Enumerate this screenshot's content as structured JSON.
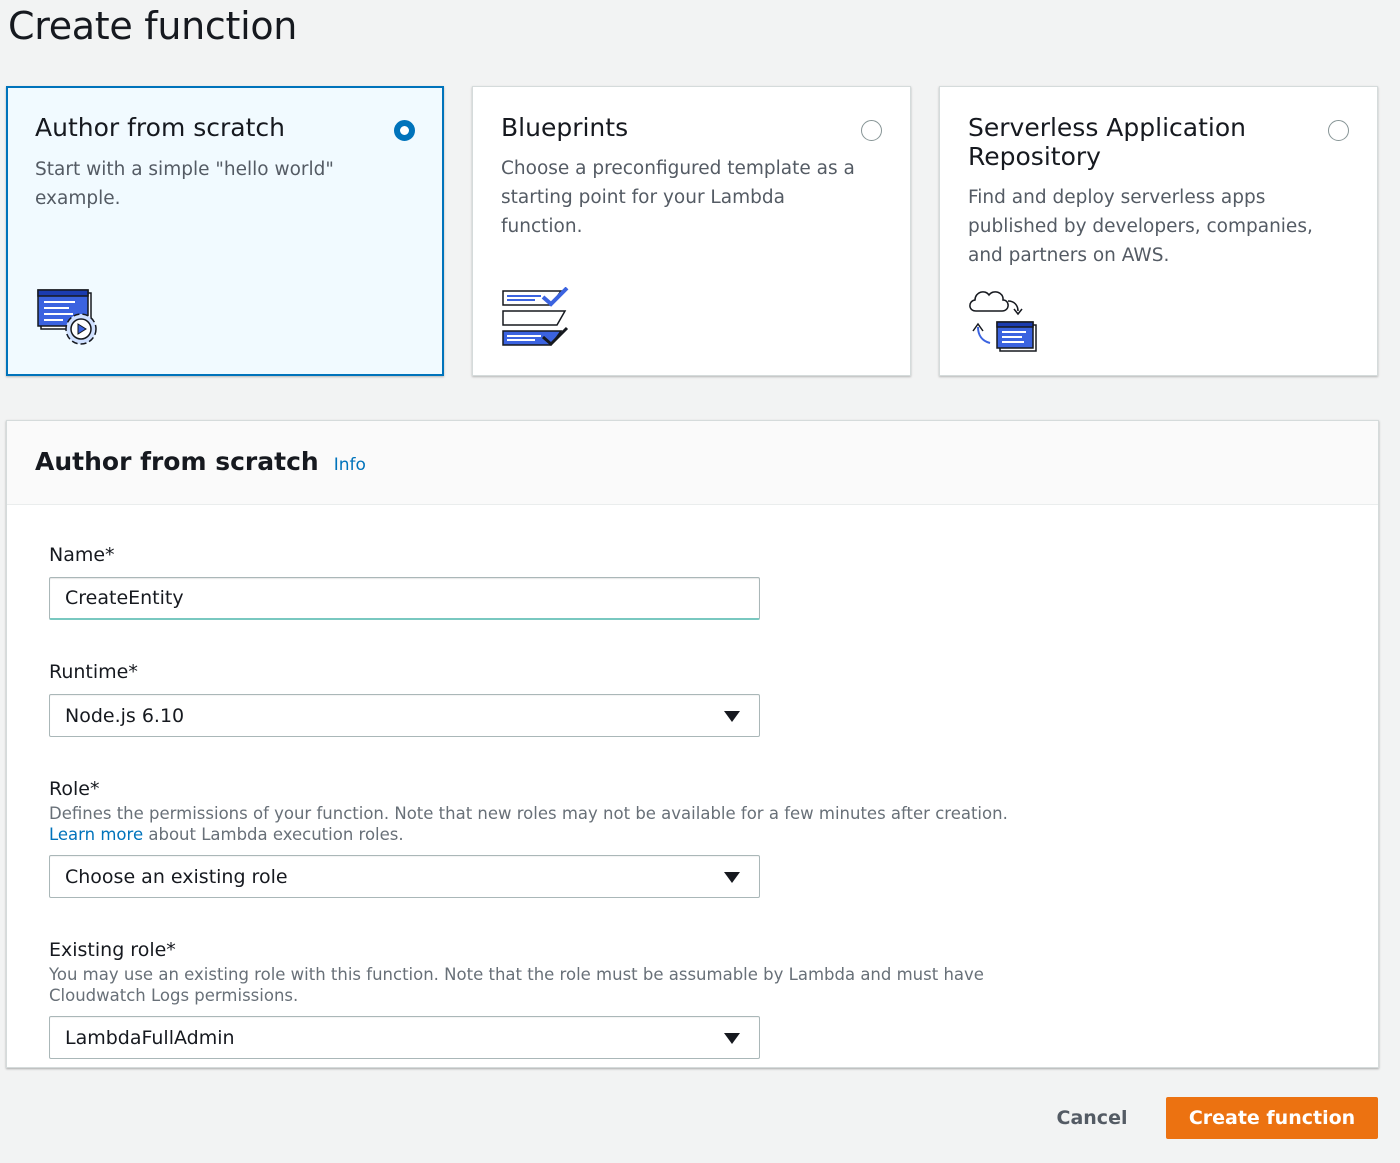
{
  "page": {
    "title": "Create function"
  },
  "options": [
    {
      "title": "Author from scratch",
      "description": "Start with a simple \"hello world\" example.",
      "selected": true,
      "icon": "code-gear-icon"
    },
    {
      "title": "Blueprints",
      "description": "Choose a preconfigured template as a starting point for your Lambda function.",
      "selected": false,
      "icon": "blueprint-checklist-icon"
    },
    {
      "title": "Serverless Application Repository",
      "description": "Find and deploy serverless apps published by developers, companies, and partners on AWS.",
      "selected": false,
      "icon": "cloud-deploy-icon"
    }
  ],
  "panel": {
    "title": "Author from scratch",
    "info_link": "Info",
    "name": {
      "label": "Name*",
      "value": "CreateEntity"
    },
    "runtime": {
      "label": "Runtime*",
      "value": "Node.js 6.10"
    },
    "role": {
      "label": "Role*",
      "description": "Defines the permissions of your function. Note that new roles may not be available for a few minutes after creation. ",
      "learn_more": "Learn more",
      "description_tail": " about Lambda execution roles.",
      "value": "Choose an existing role"
    },
    "existing_role": {
      "label": "Existing role*",
      "description": "You may use an existing role with this function. Note that the role must be assumable by Lambda and must have Cloudwatch Logs permissions.",
      "value": "LambdaFullAdmin"
    }
  },
  "actions": {
    "cancel": "Cancel",
    "create": "Create function"
  },
  "colors": {
    "accent": "#0073bb",
    "primary_button": "#ec7211",
    "selected_card_bg": "#f1faff"
  }
}
